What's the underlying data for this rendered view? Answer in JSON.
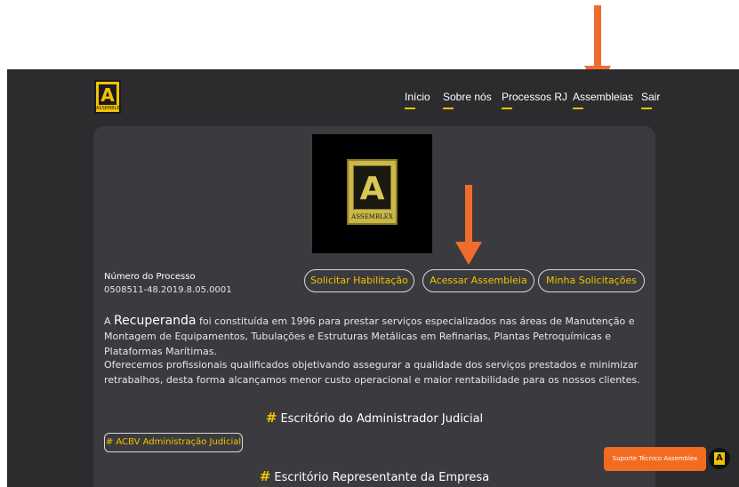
{
  "logo": {
    "letter": "A",
    "tag": "ASSEMBLEX"
  },
  "nav": {
    "items": [
      "Início",
      "Sobre nós",
      "Processos RJ",
      "Assembleias",
      "Sair"
    ]
  },
  "hero_logo": {
    "letter": "A",
    "tag": "ASSEMBLEX"
  },
  "process": {
    "label": "Número do Processo",
    "number": "0508511-48.2019.8.05.0001"
  },
  "actions": {
    "habilitacao": "Solicitar Habilitação",
    "assembleia": "Acessar Assembleia",
    "solicitacoes": "Minha Solicitações"
  },
  "about": {
    "p1_prefix": "A ",
    "p1_highlight": "Recuperanda",
    "p1_rest": " foi constituída em 1996 para prestar serviços especializados nas áreas de Manutenção e Montagem de Equipamentos, Tubulações e Estruturas Metálicas em Refinarias, Plantas Petroquímicas e Plataformas Marítimas.",
    "p2": "Oferecemos profissionais qualificados objetivando assegurar a qualidade dos serviços prestados e minimizar retrabalhos, desta forma alcançamos menor custo operacional e maior rentabilidade para os nossos clientes."
  },
  "sections": {
    "hash": "#",
    "admin_title": "Escritório do Administrador Judicial",
    "admin_tag": "# ACBV Administração Judicial",
    "company_title": "Escritório Representante da Empresa"
  },
  "support": {
    "label": "Suporte Técnico Assemblex",
    "icon_letter": "A"
  },
  "colors": {
    "accent": "#f2c200",
    "annotation": "#ef6c2e",
    "support": "#f26b21",
    "background": "#2c2c2f"
  }
}
